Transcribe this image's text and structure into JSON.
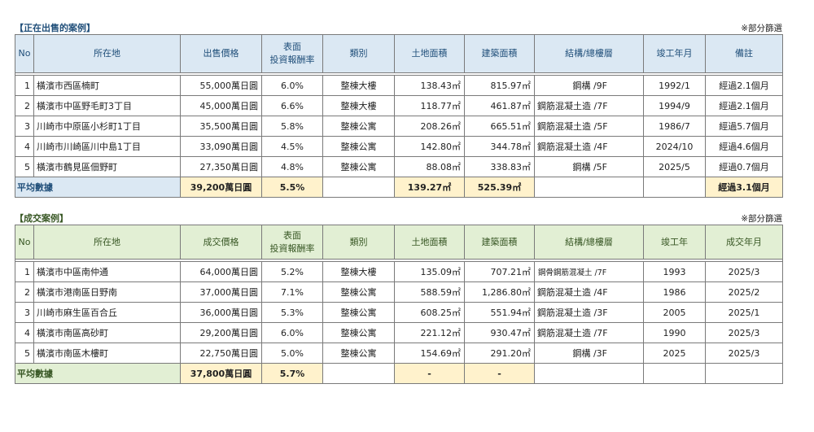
{
  "listing": {
    "title": "【正在出售的案例】",
    "note": "※部分篩選",
    "headers": [
      "No",
      "所在地",
      "出售價格",
      "表面",
      "投資報酬率",
      "類別",
      "土地面積",
      "建築面積",
      "結構/總樓層",
      "竣工年月",
      "備註"
    ],
    "rows": [
      [
        "1",
        "橫濱市西區楠町",
        "55,000萬日圓",
        "6.0%",
        "整棟大樓",
        "138.43㎡",
        "815.97㎡",
        "鋼構 /9F",
        "1992/1",
        "經過2.1個月"
      ],
      [
        "2",
        "橫濱市中區野毛町3丁目",
        "45,000萬日圓",
        "6.6%",
        "整棟大樓",
        "118.77㎡",
        "461.87㎡",
        "鋼筋混凝土造 /7F",
        "1994/9",
        "經過2.1個月"
      ],
      [
        "3",
        "川崎市中原區小杉町1丁目",
        "35,500萬日圓",
        "5.8%",
        "整棟公寓",
        "208.26㎡",
        "665.51㎡",
        "鋼筋混凝土造 /5F",
        "1986/7",
        "經過5.7個月"
      ],
      [
        "4",
        "川崎市川崎區川中島1丁目",
        "33,090萬日圓",
        "4.5%",
        "整棟公寓",
        "142.80㎡",
        "344.78㎡",
        "鋼筋混凝土造 /4F",
        "2024/10",
        "經過4.6個月"
      ],
      [
        "5",
        "橫濱市鶴見區佃野町",
        "27,350萬日圓",
        "4.8%",
        "整棟公寓",
        "88.08㎡",
        "338.83㎡",
        "鋼構 /5F",
        "2025/5",
        "經過0.7個月"
      ]
    ],
    "avg": {
      "label": "平均數據",
      "price": "39,200萬日圓",
      "yield": "5.5%",
      "land": "139.27㎡",
      "building": "525.39㎡",
      "note": "經過3.1個月"
    }
  },
  "sold": {
    "title": "【成交案例】",
    "note": "※部分篩選",
    "headers": [
      "No",
      "所在地",
      "成交價格",
      "表面",
      "投資報酬率",
      "類別",
      "土地面積",
      "建築面積",
      "結構/總樓層",
      "竣工年",
      "成交年月"
    ],
    "rows": [
      [
        "1",
        "橫濱市中區南仲通",
        "64,000萬日圓",
        "5.2%",
        "整棟大樓",
        "135.09㎡",
        "707.21㎡",
        "鋼骨鋼筋混凝土 /7F",
        "1993",
        "2025/3"
      ],
      [
        "2",
        "橫濱市港南區日野南",
        "37,000萬日圓",
        "7.1%",
        "整棟公寓",
        "588.59㎡",
        "1,286.80㎡",
        "鋼筋混凝土造 /4F",
        "1986",
        "2025/2"
      ],
      [
        "3",
        "川崎市麻生區百合丘",
        "36,000萬日圓",
        "5.3%",
        "整棟公寓",
        "608.25㎡",
        "551.94㎡",
        "鋼筋混凝土造 /3F",
        "2005",
        "2025/1"
      ],
      [
        "4",
        "橫濱市南區高砂町",
        "29,200萬日圓",
        "6.0%",
        "整棟公寓",
        "221.12㎡",
        "930.47㎡",
        "鋼筋混凝土造 /7F",
        "1990",
        "2025/3"
      ],
      [
        "5",
        "橫濱市南區木樓町",
        "22,750萬日圓",
        "5.0%",
        "整棟公寓",
        "154.69㎡",
        "291.20㎡",
        "鋼構 /3F",
        "2025",
        "2025/3"
      ]
    ],
    "avg": {
      "label": "平均數據",
      "price": "37,800萬日圓",
      "yield": "5.7%",
      "land": "-",
      "building": "-"
    }
  }
}
